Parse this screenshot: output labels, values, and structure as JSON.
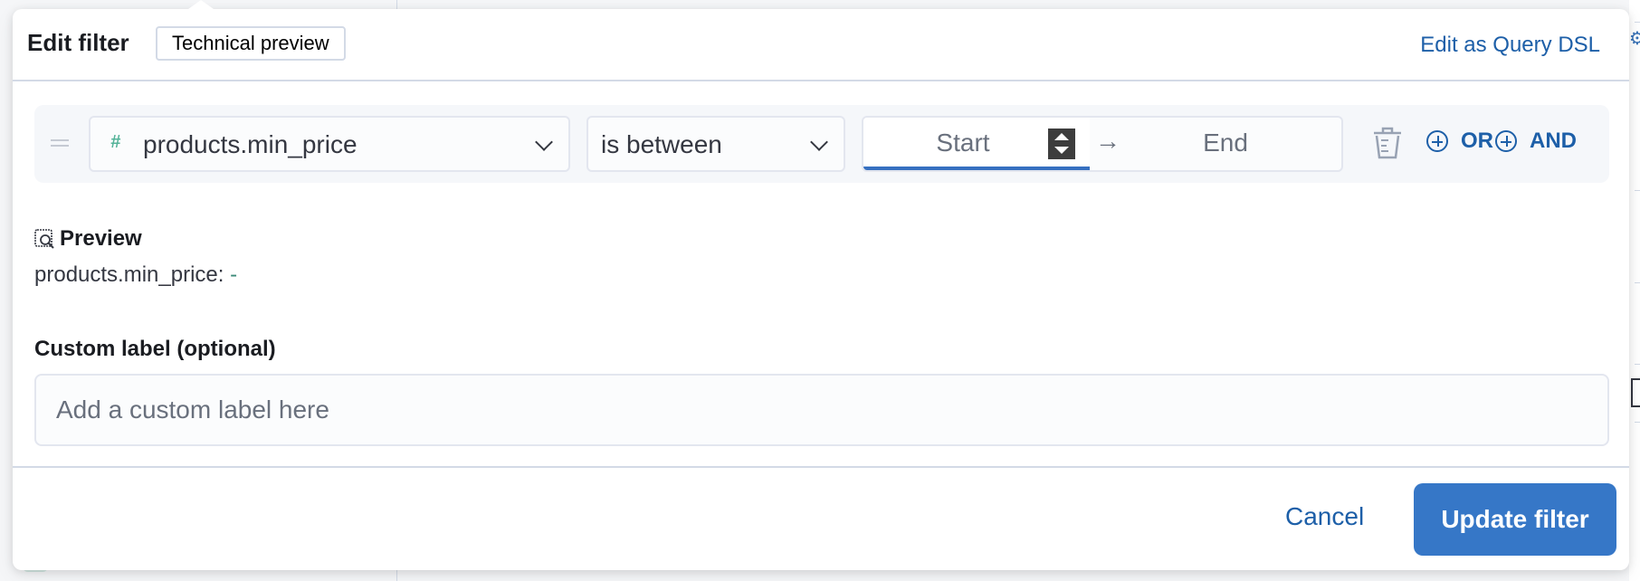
{
  "dialog": {
    "title": "Edit filter",
    "badge": "Technical preview",
    "query_dsl_link": "Edit as Query DSL"
  },
  "filter_row": {
    "field": {
      "icon": "number-hash-icon",
      "value": "products.min_price"
    },
    "operator": {
      "value": "is between"
    },
    "range": {
      "start_placeholder": "Start",
      "end_placeholder": "End",
      "separator_icon": "arrow-right-icon"
    },
    "actions": {
      "delete_icon": "trash-icon",
      "or_label": "OR",
      "and_label": "AND"
    }
  },
  "preview": {
    "title": "Preview",
    "field": "products.min_price:",
    "value": "-"
  },
  "custom_label": {
    "label": "Custom label (optional)",
    "placeholder": "Add a custom label here",
    "value": ""
  },
  "footer": {
    "cancel_label": "Cancel",
    "submit_label": "Update filter"
  },
  "colors": {
    "primary": "#3677c7",
    "link": "#1d5fa8",
    "field_type_number": "#54b399",
    "border": "#d3dae6"
  }
}
